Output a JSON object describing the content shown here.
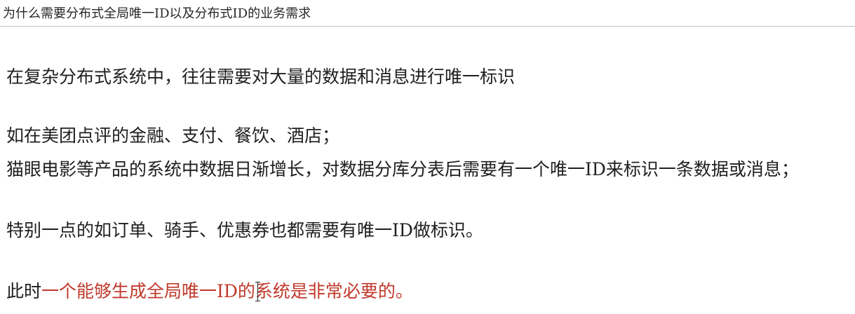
{
  "header": {
    "title": "为什么需要分布式全局唯一ID以及分布式ID的业务需求"
  },
  "content": {
    "line1": "在复杂分布式系统中，往往需要对大量的数据和消息进行唯一标识",
    "line2": "如在美团点评的金融、支付、餐饮、酒店；",
    "line3": "猫眼电影等产品的系统中数据日渐增长，对数据分库分表后需要有一个唯一ID来标识一条数据或消息；",
    "line4": "特别一点的如订单、骑手、优惠券也都需要有唯一ID做标识。",
    "line5_prefix": "此时",
    "line5_highlight": "一个能够生成全局唯一ID的系统是非常必要的。"
  },
  "colors": {
    "highlight": "#c0392b",
    "text": "#1f1f1f"
  }
}
